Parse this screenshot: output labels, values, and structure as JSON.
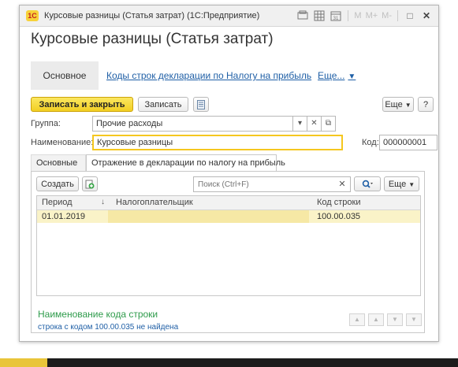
{
  "window": {
    "app_logo": "1С",
    "title": "Курсовые разницы (Статья затрат) (1С:Предприятие)",
    "title_icons": [
      "doc-icon",
      "table-icon",
      "calendar-icon"
    ],
    "memory_buttons": [
      "M",
      "M+",
      "M-"
    ],
    "maximize_icon": "□",
    "close_icon": "✕"
  },
  "form": {
    "title": "Курсовые разницы (Статья затрат)",
    "nav": {
      "active": "Основное",
      "link": "Коды строк декларации по Налогу на прибыль",
      "more": "Еще..."
    },
    "toolbar": {
      "save_close": "Записать и закрыть",
      "save": "Записать",
      "more": "Еще",
      "help": "?"
    },
    "group": {
      "label": "Группа:",
      "value": "Прочие расходы"
    },
    "name": {
      "label": "Наименование:",
      "value": "Курсовые разницы"
    },
    "code": {
      "label": "Код:",
      "value": "000000001"
    }
  },
  "tabs": [
    {
      "label": "Основные",
      "active": false
    },
    {
      "label": "Отражение в декларации по налогу на прибыль",
      "active": true
    }
  ],
  "list": {
    "create": "Создать",
    "search_placeholder": "Поиск (Ctrl+F)",
    "more": "Еще",
    "columns": [
      "Период",
      "Налогоплательщик",
      "Код строки"
    ],
    "rows": [
      {
        "period": "01.01.2019",
        "payer": "",
        "code": "100.00.035"
      }
    ]
  },
  "info": {
    "title": "Наименование кода строки",
    "text": "строка с кодом 100.00.035 не найдена"
  },
  "colors": {
    "accent": "#f5c71f",
    "link": "#1f5fa6",
    "info_green": "#2e9b4b",
    "selected_row": "#faf3c8"
  }
}
